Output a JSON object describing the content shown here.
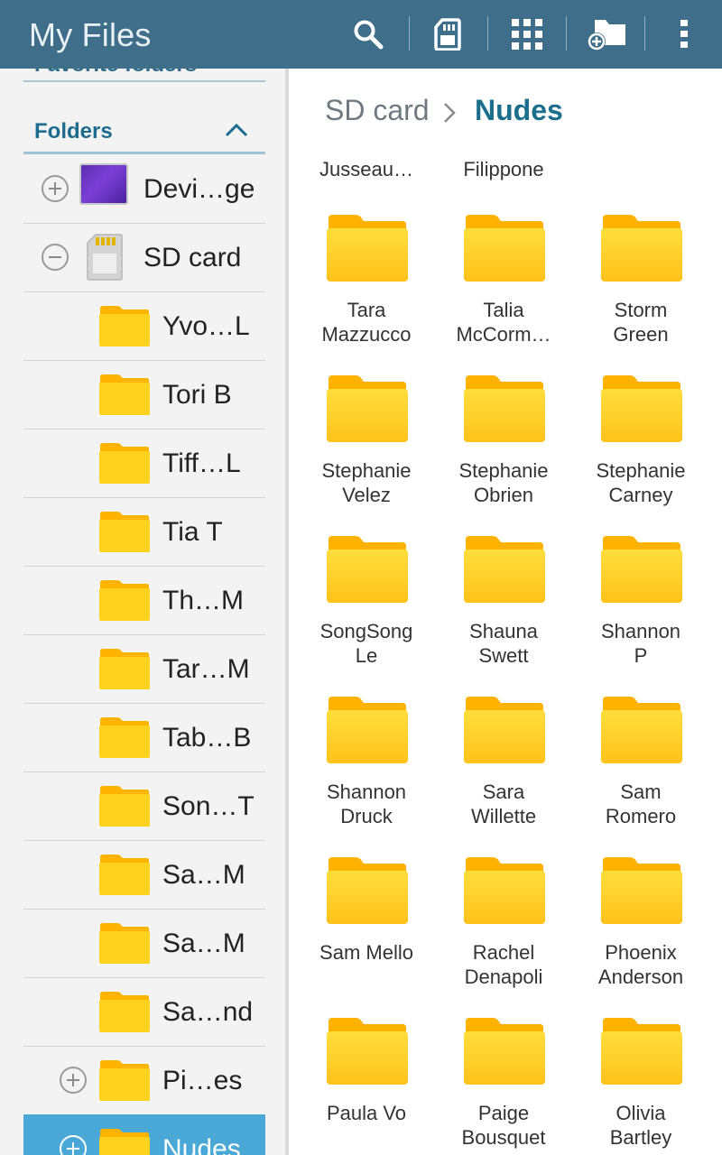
{
  "appbar": {
    "title": "My Files",
    "actions": [
      {
        "name": "search-icon"
      },
      {
        "name": "sd-card-icon"
      },
      {
        "name": "view-grid-icon"
      },
      {
        "name": "create-folder-icon"
      },
      {
        "name": "more-options-icon"
      }
    ]
  },
  "sidebar": {
    "favorites_label": "Favorite folders",
    "folders_label": "Folders",
    "tree": [
      {
        "label": "Devi…ge",
        "toggle": "plus",
        "icon": "device-storage-icon",
        "indent": 0
      },
      {
        "label": "SD card",
        "toggle": "minus",
        "icon": "sd-card-icon",
        "indent": 0
      },
      {
        "label": "Yvo…L",
        "toggle": null,
        "icon": "folder-icon",
        "indent": 1
      },
      {
        "label": "Tori B",
        "toggle": null,
        "icon": "folder-icon",
        "indent": 1
      },
      {
        "label": "Tiff…L",
        "toggle": null,
        "icon": "folder-icon",
        "indent": 1
      },
      {
        "label": "Tia T",
        "toggle": null,
        "icon": "folder-icon",
        "indent": 1
      },
      {
        "label": "Th…M",
        "toggle": null,
        "icon": "folder-icon",
        "indent": 1
      },
      {
        "label": "Tar…M",
        "toggle": null,
        "icon": "folder-icon",
        "indent": 1
      },
      {
        "label": "Tab…B",
        "toggle": null,
        "icon": "folder-icon",
        "indent": 1
      },
      {
        "label": "Son…T",
        "toggle": null,
        "icon": "folder-icon",
        "indent": 1
      },
      {
        "label": "Sa…M",
        "toggle": null,
        "icon": "folder-icon",
        "indent": 1
      },
      {
        "label": "Sa…M",
        "toggle": null,
        "icon": "folder-icon",
        "indent": 1
      },
      {
        "label": "Sa…nd",
        "toggle": null,
        "icon": "folder-icon",
        "indent": 1
      },
      {
        "label": "Pi…es",
        "toggle": "plus",
        "icon": "folder-icon",
        "indent": 1
      },
      {
        "label": "Nudes",
        "toggle": "plus",
        "icon": "folder-icon",
        "indent": 1,
        "selected": true
      }
    ]
  },
  "breadcrumb": {
    "root": "SD card",
    "current": "Nudes"
  },
  "grid": {
    "partial_row": [
      "Jusseau…",
      "Filippone"
    ],
    "folders": [
      "Tara Mazzucco",
      "Talia McCorm…",
      "Storm Green",
      "Stephanie Velez",
      "Stephanie Obrien",
      "Stephanie Carney",
      "SongSong Le",
      "Shauna Swett",
      "Shannon P",
      "Shannon Druck",
      "Sara Willette",
      "Sam Romero",
      "Sam Mello",
      "Rachel Denapoli",
      "Phoenix Anderson",
      "Paula Vo",
      "Paige Bousquet",
      "Olivia Bartley"
    ]
  },
  "colors": {
    "appbar": "#3e6e8a",
    "accent": "#1b6e8c",
    "selected_row": "#4aa8d6",
    "folder_fill": "#ffd21f",
    "folder_tab": "#ffb300"
  }
}
